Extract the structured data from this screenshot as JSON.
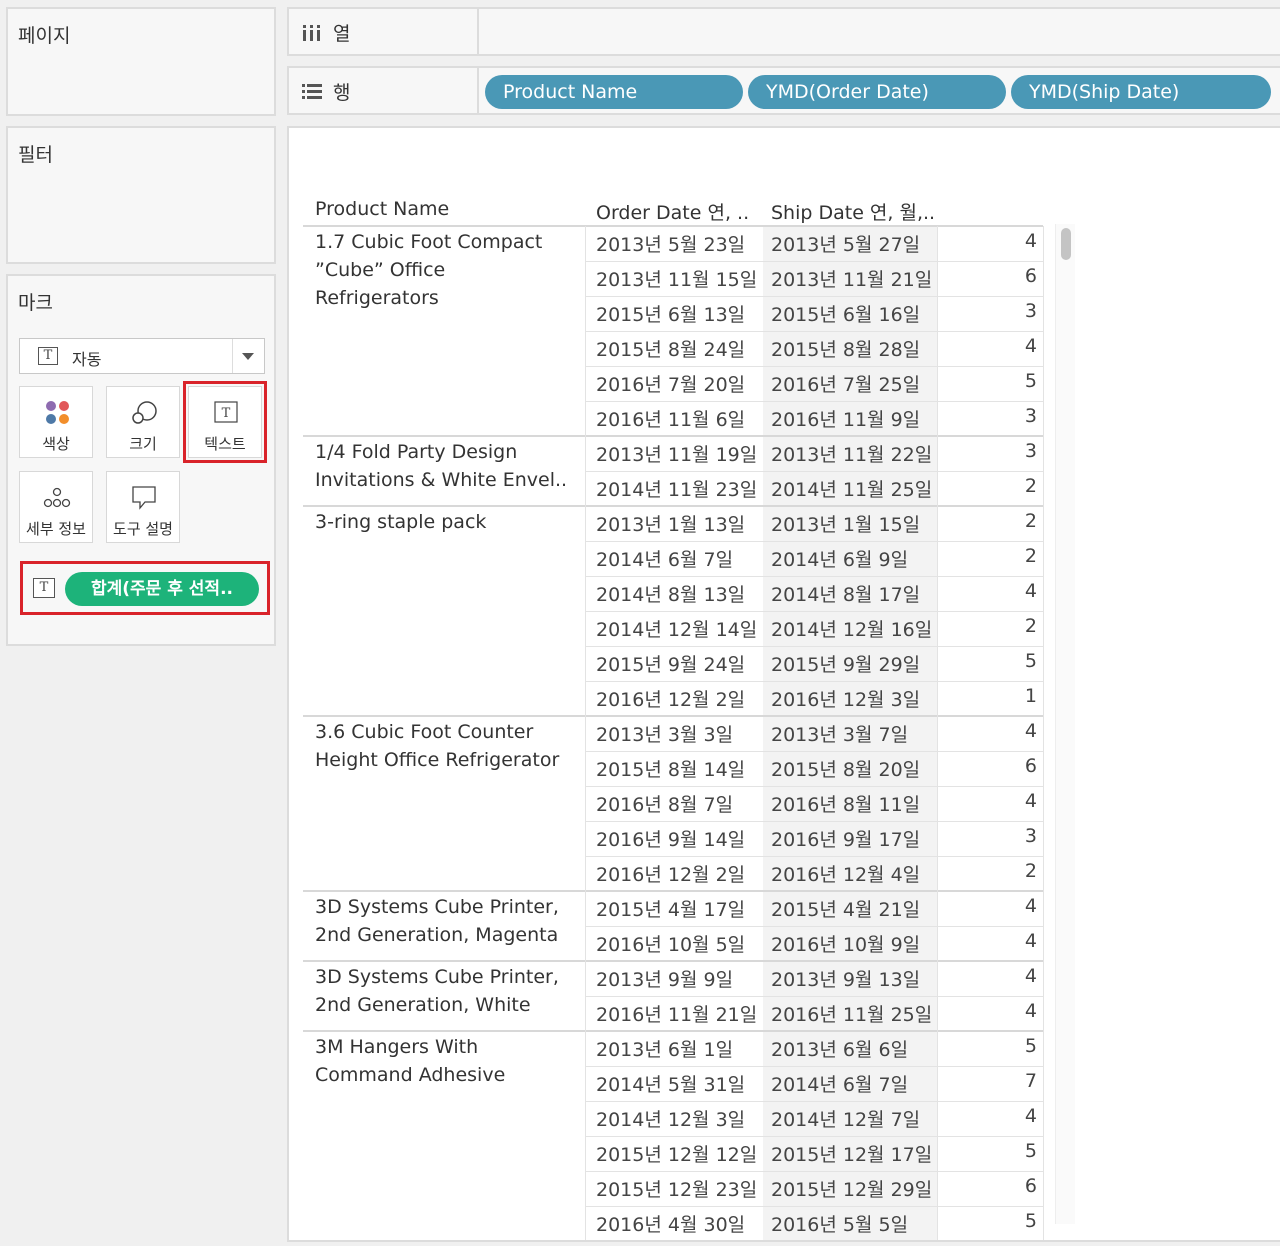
{
  "pages": {
    "title": "페이지"
  },
  "filters": {
    "title": "필터"
  },
  "marks": {
    "title": "마크",
    "mark_type": "자동",
    "buttons": [
      {
        "label": "색상",
        "icon": "color-dots-icon"
      },
      {
        "label": "크기",
        "icon": "size-circles-icon"
      },
      {
        "label": "텍스트",
        "icon": "text-t-icon"
      },
      {
        "label": "세부 정보",
        "icon": "detail-dots-icon"
      },
      {
        "label": "도구 설명",
        "icon": "tooltip-bubble-icon"
      }
    ],
    "text_pill": "합계(주문 후 선적..",
    "t_glyph": "T"
  },
  "columns_shelf": {
    "label": "열"
  },
  "rows_shelf": {
    "label": "행",
    "pills": [
      "Product Name",
      "YMD(Order Date)",
      "YMD(Ship Date)"
    ]
  },
  "table": {
    "headers": [
      "Product Name",
      "Order Date 연, ..",
      "Ship Date 연, 월,.."
    ],
    "groups": [
      {
        "product": "1.7 Cubic Foot Compact\n”Cube” Office\nRefrigerators",
        "rows": [
          [
            "2013년 5월 23일",
            "2013년 5월 27일",
            "4"
          ],
          [
            "2013년 11월 15일",
            "2013년 11월 21일",
            "6"
          ],
          [
            "2015년 6월 13일",
            "2015년 6월 16일",
            "3"
          ],
          [
            "2015년 8월 24일",
            "2015년 8월 28일",
            "4"
          ],
          [
            "2016년 7월 20일",
            "2016년 7월 25일",
            "5"
          ],
          [
            "2016년 11월 6일",
            "2016년 11월 9일",
            "3"
          ]
        ]
      },
      {
        "product": "1/4 Fold Party Design\nInvitations & White Envel..",
        "rows": [
          [
            "2013년 11월 19일",
            "2013년 11월 22일",
            "3"
          ],
          [
            "2014년 11월 23일",
            "2014년 11월 25일",
            "2"
          ]
        ]
      },
      {
        "product": "3-ring staple pack",
        "rows": [
          [
            "2013년 1월 13일",
            "2013년 1월 15일",
            "2"
          ],
          [
            "2014년 6월 7일",
            "2014년 6월 9일",
            "2"
          ],
          [
            "2014년 8월 13일",
            "2014년 8월 17일",
            "4"
          ],
          [
            "2014년 12월 14일",
            "2014년 12월 16일",
            "2"
          ],
          [
            "2015년 9월 24일",
            "2015년 9월 29일",
            "5"
          ],
          [
            "2016년 12월 2일",
            "2016년 12월 3일",
            "1"
          ]
        ]
      },
      {
        "product": "3.6 Cubic Foot Counter\nHeight Office Refrigerator",
        "rows": [
          [
            "2013년 3월 3일",
            "2013년 3월 7일",
            "4"
          ],
          [
            "2015년 8월 14일",
            "2015년 8월 20일",
            "6"
          ],
          [
            "2016년 8월 7일",
            "2016년 8월 11일",
            "4"
          ],
          [
            "2016년 9월 14일",
            "2016년 9월 17일",
            "3"
          ],
          [
            "2016년 12월 2일",
            "2016년 12월 4일",
            "2"
          ]
        ]
      },
      {
        "product": "3D Systems Cube Printer,\n2nd Generation, Magenta",
        "rows": [
          [
            "2015년 4월 17일",
            "2015년 4월 21일",
            "4"
          ],
          [
            "2016년 10월 5일",
            "2016년 10월 9일",
            "4"
          ]
        ]
      },
      {
        "product": "3D Systems Cube Printer,\n2nd Generation, White",
        "rows": [
          [
            "2013년 9월 9일",
            "2013년 9월 13일",
            "4"
          ],
          [
            "2016년 11월 21일",
            "2016년 11월 25일",
            "4"
          ]
        ]
      },
      {
        "product": "3M Hangers With\nCommand Adhesive",
        "rows": [
          [
            "2013년 6월 1일",
            "2013년 6월 6일",
            "5"
          ],
          [
            "2014년 5월 31일",
            "2014년 6월 7일",
            "7"
          ],
          [
            "2014년 12월 3일",
            "2014년 12월 7일",
            "4"
          ],
          [
            "2015년 12월 12일",
            "2015년 12월 17일",
            "5"
          ],
          [
            "2015년 12월 23일",
            "2015년 12월 29일",
            "6"
          ],
          [
            "2016년 4월 30일",
            "2016년 5월 5일",
            "5"
          ]
        ]
      }
    ]
  },
  "colors": {
    "row_pill": "#4a98b6",
    "measure_pill": "#1db37a",
    "highlight": "#d9232a",
    "color_dots": [
      "#e15759",
      "#4e79a7",
      "#f28e2b",
      "#76b7b2"
    ]
  }
}
